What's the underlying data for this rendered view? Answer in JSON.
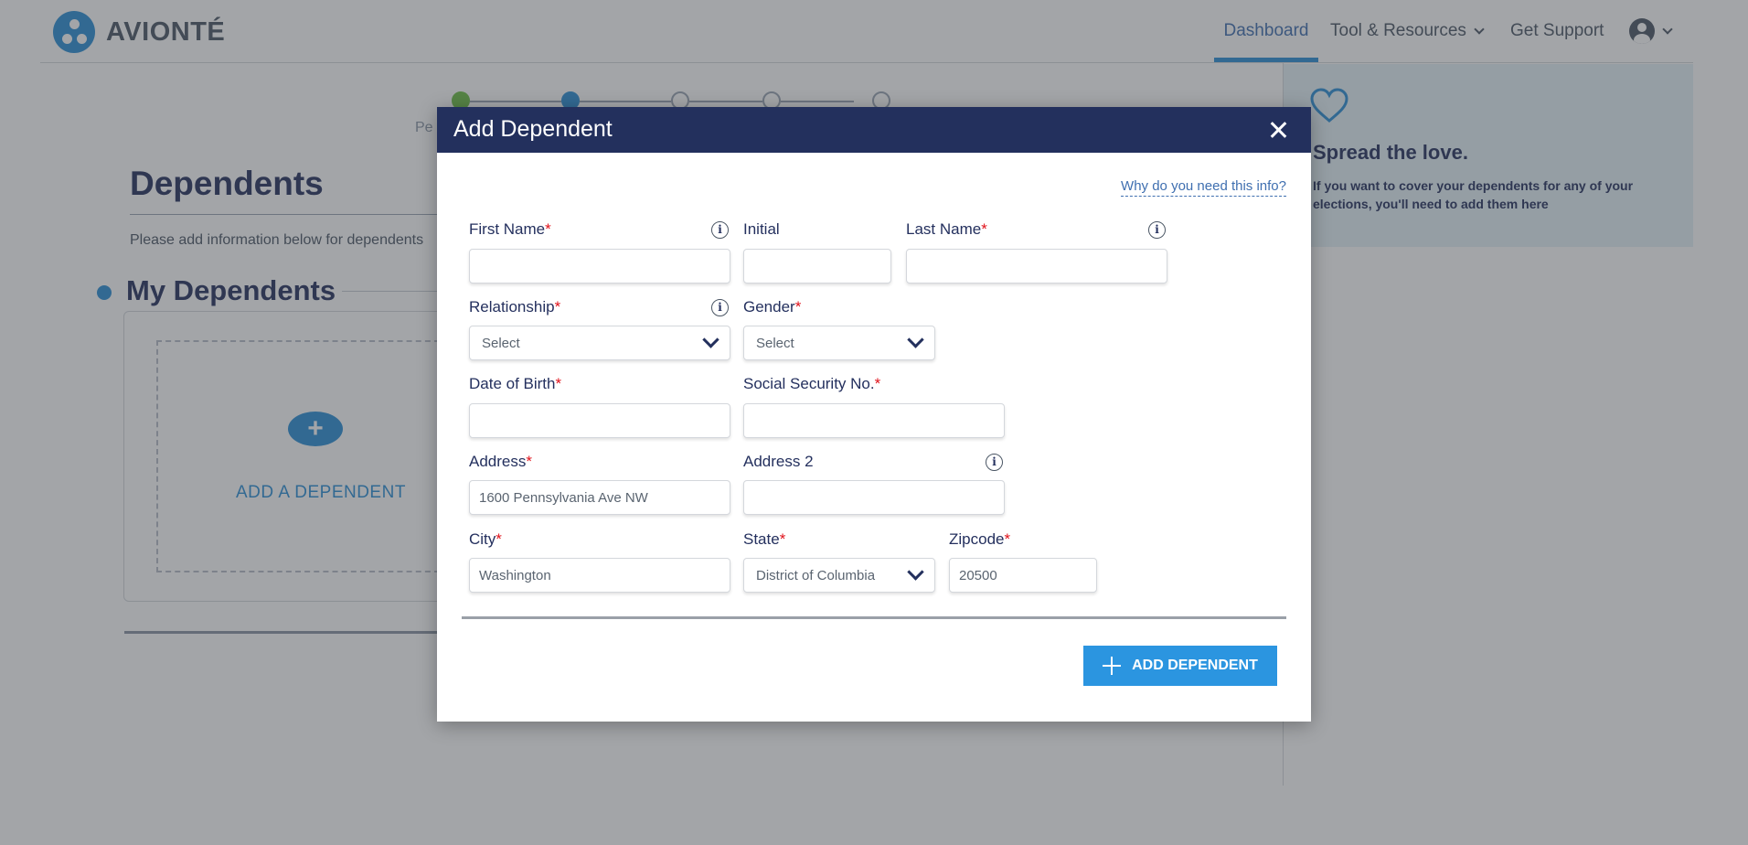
{
  "header": {
    "brand": "AVIONTÉ",
    "nav": {
      "dashboard": "Dashboard",
      "tools": "Tool & Resources",
      "support": "Get Support"
    }
  },
  "stepper": {
    "current_label": "Pe"
  },
  "page": {
    "title": "Dependents",
    "description": "Please add information below for dependents",
    "section_title": "My Dependents",
    "add_dependent_label": "ADD A DEPENDENT",
    "add_plus": "+"
  },
  "promo": {
    "title": "Spread the love.",
    "text": "If you want to cover your dependents for any of your elections, you'll need to add them here"
  },
  "modal": {
    "title": "Add Dependent",
    "why_link": "Why do you need this info?",
    "required_marker": "*",
    "info_glyph": "i",
    "fields": {
      "first_name": {
        "label": "First Name",
        "value": ""
      },
      "initial": {
        "label": "Initial",
        "value": ""
      },
      "last_name": {
        "label": "Last Name",
        "value": ""
      },
      "relationship": {
        "label": "Relationship",
        "value": "Select"
      },
      "gender": {
        "label": "Gender",
        "value": "Select"
      },
      "dob": {
        "label": "Date of Birth",
        "value": ""
      },
      "ssn": {
        "label": "Social Security No.",
        "value": ""
      },
      "address": {
        "label": "Address",
        "value": "1600 Pennsylvania Ave NW"
      },
      "address2": {
        "label": "Address 2",
        "value": ""
      },
      "city": {
        "label": "City",
        "value": "Washington"
      },
      "state": {
        "label": "State",
        "value": "District of Columbia"
      },
      "zipcode": {
        "label": "Zipcode",
        "value": "20500"
      }
    },
    "submit_label": "ADD DEPENDENT"
  },
  "colors": {
    "brand_blue": "#2b8fd6",
    "modal_header": "#23305d",
    "required": "#e0121b",
    "step_done": "#6cbf45"
  }
}
